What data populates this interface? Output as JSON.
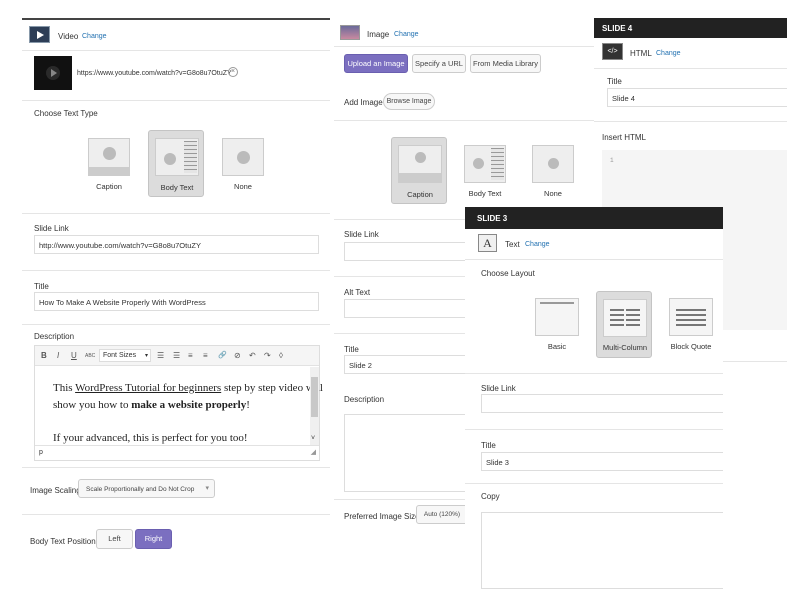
{
  "video_panel": {
    "type_label": "Video",
    "change_link": "Change",
    "video_url": "https://www.youtube.com/watch?v=G8o8u7OtuZY",
    "choose_text_type_label": "Choose Text Type",
    "text_type_options": [
      "Caption",
      "Body Text",
      "None"
    ],
    "slide_link_label": "Slide Link",
    "slide_link_value": "http://www.youtube.com/watch?v=G8o8u7OtuZY",
    "title_label": "Title",
    "title_value": "How To Make A Website Properly With WordPress",
    "description_label": "Description",
    "toolbar": {
      "bold": "B",
      "italic": "I",
      "underline": "U",
      "strikethrough": "ABC",
      "font_sizes_label": "Font Sizes",
      "bullet_list": "☰",
      "numbered_list": "☰",
      "align_left": "≡",
      "align_right": "≡",
      "link": "🔗",
      "unlink": "⊘",
      "undo": "↶",
      "redo": "↷",
      "clear": "◊"
    },
    "editor": {
      "line1_part1": "This ",
      "line1_link": "WordPress Tutorial for beginners",
      "line1_part2": " step by step video will",
      "line2_part1": "show you how to ",
      "line2_bold": "make a website properly",
      "line2_part2": "!",
      "line3": "If your advanced, this is perfect for you too!",
      "status_path": "p"
    },
    "image_scaling_label": "Image Scaling",
    "image_scaling_value": "Scale Proportionally and Do Not Crop",
    "body_text_position_label": "Body Text Position",
    "position_options": [
      "Left",
      "Right"
    ],
    "position_selected": "Right"
  },
  "image_panel": {
    "type_label": "Image",
    "change_link": "Change",
    "tabs": [
      "Upload an Image",
      "Specify a URL",
      "From Media Library"
    ],
    "active_tab": "Upload an Image",
    "add_image_label": "Add Image",
    "browse_button": "Browse Image",
    "text_type_options": [
      "Caption",
      "Body Text",
      "None"
    ],
    "slide_link_label": "Slide Link",
    "alt_text_label": "Alt Text",
    "title_label": "Title",
    "title_value": "Slide 2",
    "description_label": "Description",
    "preferred_image_size_label": "Preferred Image Size",
    "preferred_image_size_value": "Auto (120%)"
  },
  "slide4_panel": {
    "header": "SLIDE 4",
    "type_label": "HTML",
    "change_link": "Change",
    "title_label": "Title",
    "title_value": "Slide 4",
    "insert_html_label": "Insert HTML",
    "line_number": "1"
  },
  "slide3_panel": {
    "header": "SLIDE 3",
    "type_label": "Text",
    "change_link": "Change",
    "choose_layout_label": "Choose Layout",
    "layout_options": [
      "Basic",
      "Multi-Column",
      "Block Quote"
    ],
    "layout_selected": "Multi-Column",
    "slide_link_label": "Slide Link",
    "title_label": "Title",
    "title_value": "Slide 3",
    "copy_label": "Copy"
  },
  "colors": {
    "accent": "#7b6fc0",
    "link": "#2271b1",
    "header_bg": "#222222"
  }
}
